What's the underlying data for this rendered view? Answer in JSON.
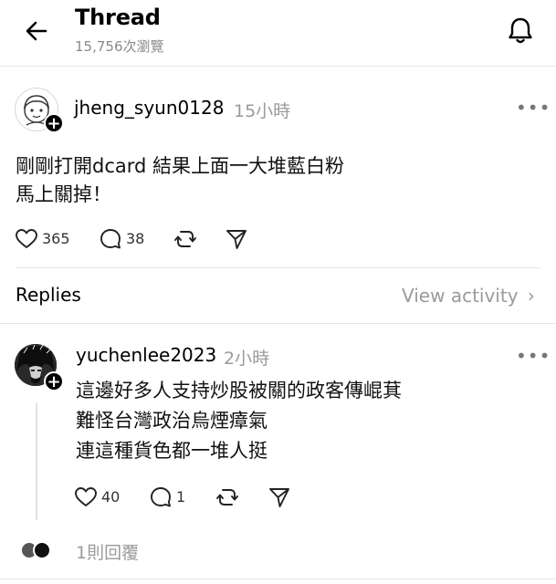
{
  "header": {
    "title": "Thread",
    "views": "15,756次瀏覽"
  },
  "post": {
    "author": "jheng_syun0128",
    "time": "15小時",
    "more": "•••",
    "lines": [
      "剛剛打開dcard 結果上面一大堆藍白粉",
      "馬上關掉！"
    ],
    "likes": "365",
    "comments": "38"
  },
  "replies_header": {
    "label": "Replies",
    "view_activity": "View activity",
    "chevron": "›"
  },
  "reply": {
    "author": "yuchenlee2023",
    "time": "2小時",
    "more": "•••",
    "lines": [
      "這邊好多人支持炒股被關的政客傳崐萁",
      "難怪台灣政治烏煙瘴氣",
      "連這種貨色都一堆人挺"
    ],
    "likes": "40",
    "comments": "1",
    "reply_count": "1則回覆"
  },
  "icons": {
    "back": "arrow-left-icon",
    "notifications": "bell-icon",
    "like": "heart-icon",
    "comment": "comment-icon",
    "repost": "repost-icon",
    "share": "send-icon"
  },
  "colors": {
    "muted": "#9a9a9a",
    "divider": "#e6e6e6",
    "text": "#000000"
  }
}
